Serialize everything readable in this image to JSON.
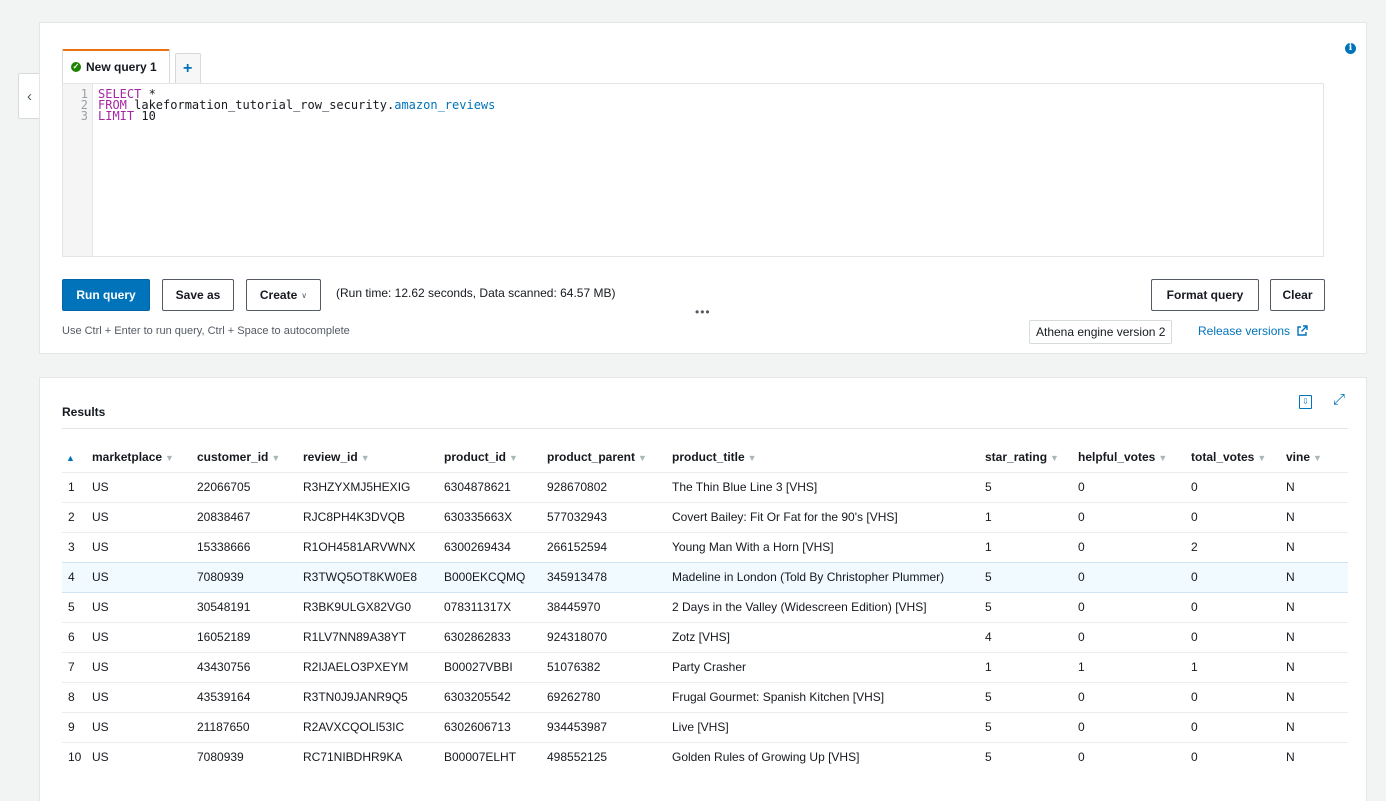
{
  "editor": {
    "tab_label": "New query 1",
    "add_tab_icon": "+",
    "collapse_icon": "‹",
    "line_numbers": [
      "1",
      "2",
      "3"
    ],
    "lines": [
      {
        "kw": "SELECT",
        "rest": " *",
        "tbl": ""
      },
      {
        "kw": "FROM",
        "rest": " lakeformation_tutorial_row_security.",
        "tbl": "amazon_reviews"
      },
      {
        "kw": "LIMIT",
        "rest": " 10",
        "tbl": ""
      }
    ]
  },
  "toolbar": {
    "run_query": "Run query",
    "save_as": "Save as",
    "create": "Create",
    "run_info": "(Run time: 12.62 seconds, Data scanned: 64.57 MB)",
    "format_query": "Format query",
    "clear": "Clear",
    "hint": "Use Ctrl + Enter to run query, Ctrl + Space to autocomplete",
    "engine_version": "Athena engine version 2",
    "release_versions": "Release versions",
    "dots": "•••"
  },
  "results": {
    "title": "Results",
    "columns": [
      "marketplace",
      "customer_id",
      "review_id",
      "product_id",
      "product_parent",
      "product_title",
      "star_rating",
      "helpful_votes",
      "total_votes",
      "vine"
    ],
    "rows": [
      [
        "1",
        "US",
        "22066705",
        "R3HZYXMJ5HEXIG",
        "6304878621",
        "928670802",
        "The Thin Blue Line 3 [VHS]",
        "5",
        "0",
        "0",
        "N"
      ],
      [
        "2",
        "US",
        "20838467",
        "RJC8PH4K3DVQB",
        "630335663X",
        "577032943",
        "Covert Bailey: Fit Or Fat for the 90's [VHS]",
        "1",
        "0",
        "0",
        "N"
      ],
      [
        "3",
        "US",
        "15338666",
        "R1OH4581ARVWNX",
        "6300269434",
        "266152594",
        "Young Man With a Horn [VHS]",
        "1",
        "0",
        "2",
        "N"
      ],
      [
        "4",
        "US",
        "7080939",
        "R3TWQ5OT8KW0E8",
        "B000EKCQMQ",
        "345913478",
        "Madeline in London (Told By Christopher Plummer)",
        "5",
        "0",
        "0",
        "N"
      ],
      [
        "5",
        "US",
        "30548191",
        "R3BK9ULGX82VG0",
        "078311317X",
        "38445970",
        "2 Days in the Valley (Widescreen Edition) [VHS]",
        "5",
        "0",
        "0",
        "N"
      ],
      [
        "6",
        "US",
        "16052189",
        "R1LV7NN89A38YT",
        "6302862833",
        "924318070",
        "Zotz [VHS]",
        "4",
        "0",
        "0",
        "N"
      ],
      [
        "7",
        "US",
        "43430756",
        "R2IJAELO3PXEYM",
        "B00027VBBI",
        "51076382",
        "Party Crasher",
        "1",
        "1",
        "1",
        "N"
      ],
      [
        "8",
        "US",
        "43539164",
        "R3TN0J9JANR9Q5",
        "6303205542",
        "69262780",
        "Frugal Gourmet: Spanish Kitchen [VHS]",
        "5",
        "0",
        "0",
        "N"
      ],
      [
        "9",
        "US",
        "21187650",
        "R2AVXCQOLI53IC",
        "6302606713",
        "934453987",
        "Live [VHS]",
        "5",
        "0",
        "0",
        "N"
      ],
      [
        "10",
        "US",
        "7080939",
        "RC71NIBDHR9KA",
        "B00007ELHT",
        "498552125",
        "Golden Rules of Growing Up [VHS]",
        "5",
        "0",
        "0",
        "N"
      ]
    ],
    "selected_row": 3
  },
  "colors": {
    "primary": "#0073bb",
    "tab_accent": "#ec7211",
    "success": "#1d8102",
    "selected_row": "#f1faff"
  }
}
